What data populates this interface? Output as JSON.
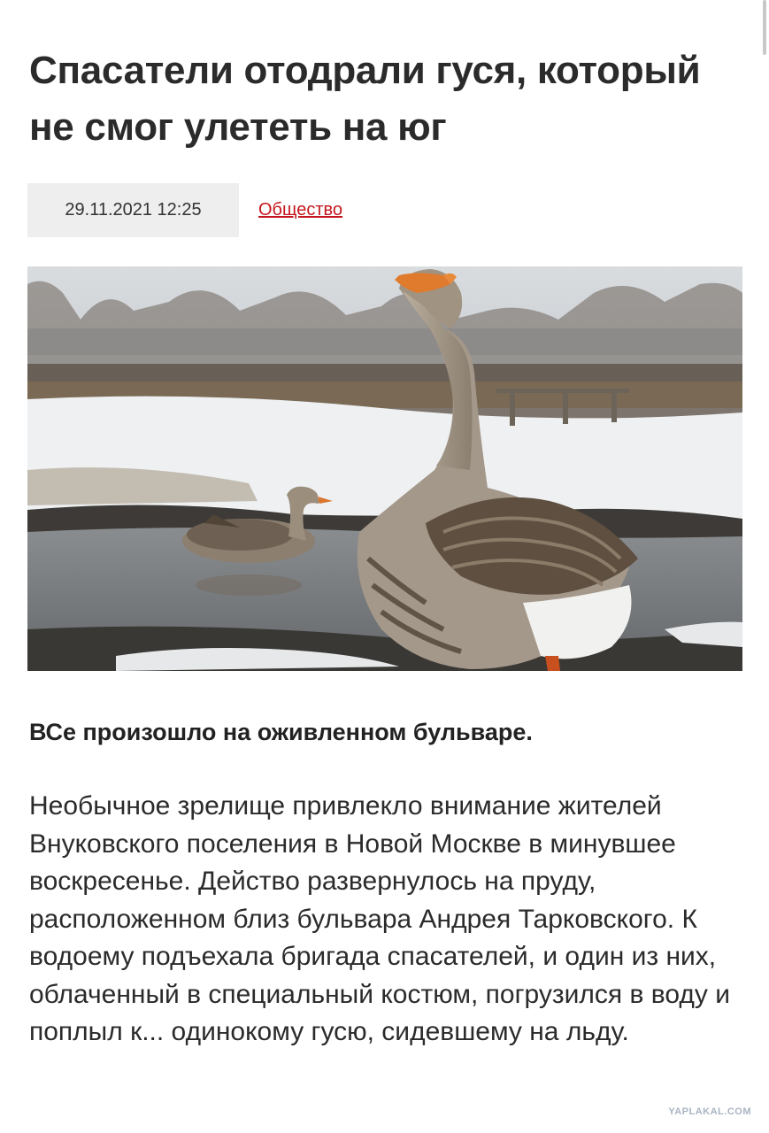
{
  "article": {
    "title": "Спасатели отодрали гуся, который не смог улететь на юг",
    "datetime": "29.11.2021 12:25",
    "category": "Общество",
    "lead": "ВСе произошло на оживленном бульваре.",
    "body": "Необычное зрелище привлекло внимание жителей Внуковского поселения в Новой Москве в минувшее воскресенье. Действо развернулось на пруду, расположенном близ бульвара Андрея Тарковского. К водоему подъехала бригада спасателей, и один из них, облаченный в специальный костюм, погрузился в воду и поплыл к... одинокому гусю, сидевшему на льду."
  },
  "watermark": "YAPLAKAL.COM"
}
